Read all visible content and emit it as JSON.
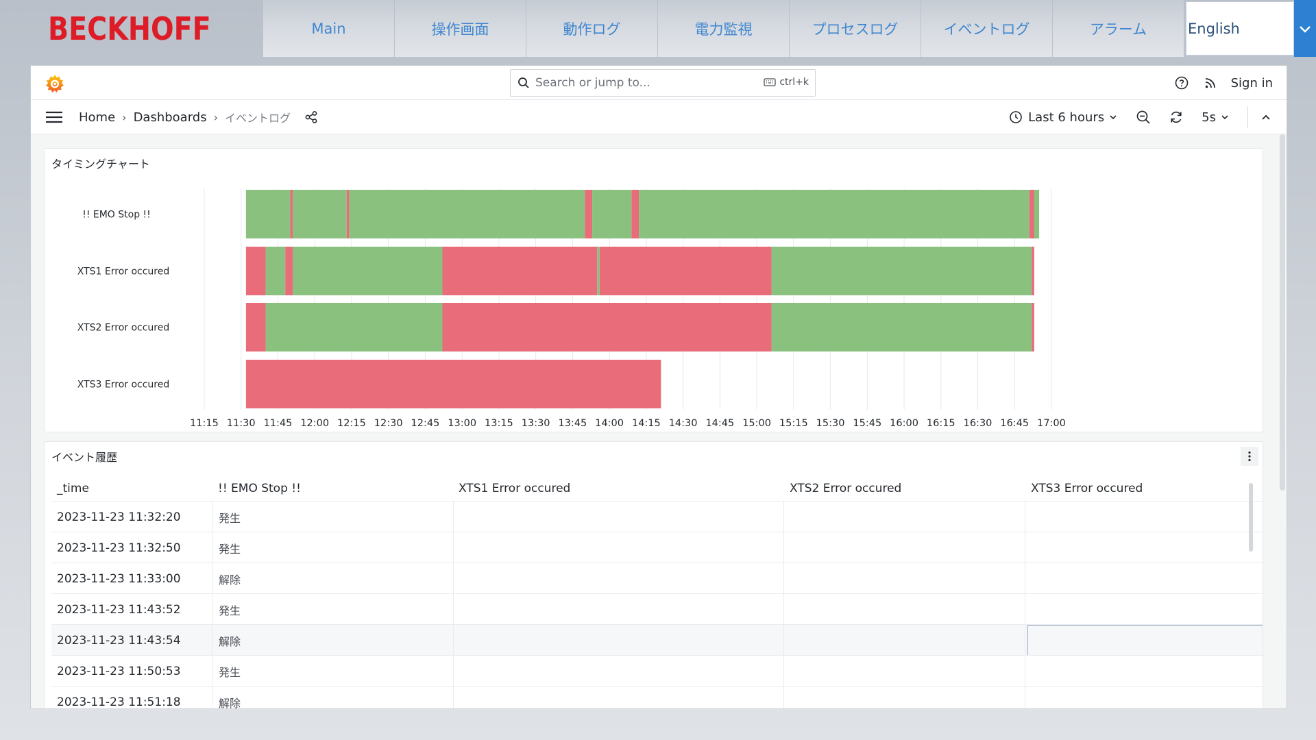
{
  "topnav": {
    "brand": "BECKHOFF",
    "tabs": [
      "Main",
      "操作画面",
      "動作ログ",
      "電力監視",
      "プロセスログ",
      "イベントログ",
      "アラーム"
    ],
    "language": "English"
  },
  "header": {
    "search_placeholder": "Search or jump to...",
    "search_shortcut": "ctrl+k",
    "sign_in": "Sign in"
  },
  "toolbar": {
    "breadcrumbs": [
      "Home",
      "Dashboards",
      "イベントログ"
    ],
    "time_range": "Last 6 hours",
    "refresh_interval": "5s"
  },
  "timing_panel": {
    "title": "タイミングチャート"
  },
  "colors": {
    "ok": "#8ac17f",
    "alarm": "#e86c7a",
    "brand_red": "#dd1c28",
    "nav_text": "#3f86cf",
    "accent_blue": "#2d80d2"
  },
  "chart_data": {
    "type": "state-timeline",
    "x_unit": "time (HH:MM)",
    "x_ticks": [
      "11:15",
      "11:30",
      "11:45",
      "12:00",
      "12:15",
      "12:30",
      "12:45",
      "13:00",
      "13:15",
      "13:30",
      "13:45",
      "14:00",
      "14:15",
      "14:30",
      "14:45",
      "15:00",
      "15:15",
      "15:30",
      "15:45",
      "16:00",
      "16:15",
      "16:30",
      "16:45",
      "17:00"
    ],
    "xlim": [
      "11:15",
      "17:00"
    ],
    "rows": [
      {
        "name": "!! EMO Stop !!",
        "segments": [
          {
            "start": "11:32",
            "end": "11:50",
            "state": "ok"
          },
          {
            "start": "11:50",
            "end": "11:51",
            "state": "alarm"
          },
          {
            "start": "11:51",
            "end": "12:13",
            "state": "ok"
          },
          {
            "start": "12:13",
            "end": "12:14",
            "state": "alarm"
          },
          {
            "start": "12:14",
            "end": "13:50",
            "state": "ok"
          },
          {
            "start": "13:50",
            "end": "13:53",
            "state": "alarm"
          },
          {
            "start": "13:53",
            "end": "14:09",
            "state": "ok"
          },
          {
            "start": "14:09",
            "end": "14:12",
            "state": "alarm"
          },
          {
            "start": "14:12",
            "end": "16:51",
            "state": "ok"
          },
          {
            "start": "16:51",
            "end": "16:53",
            "state": "alarm"
          },
          {
            "start": "16:53",
            "end": "16:55",
            "state": "ok"
          }
        ]
      },
      {
        "name": "XTS1 Error occured",
        "segments": [
          {
            "start": "11:32",
            "end": "11:40",
            "state": "alarm"
          },
          {
            "start": "11:40",
            "end": "11:48",
            "state": "ok"
          },
          {
            "start": "11:48",
            "end": "11:51",
            "state": "alarm"
          },
          {
            "start": "11:51",
            "end": "12:52",
            "state": "ok"
          },
          {
            "start": "12:52",
            "end": "13:55",
            "state": "alarm"
          },
          {
            "start": "13:55",
            "end": "13:56",
            "state": "ok"
          },
          {
            "start": "13:56",
            "end": "15:06",
            "state": "alarm"
          },
          {
            "start": "15:06",
            "end": "16:52",
            "state": "ok"
          },
          {
            "start": "16:52",
            "end": "16:53",
            "state": "alarm"
          }
        ]
      },
      {
        "name": "XTS2 Error occured",
        "segments": [
          {
            "start": "11:32",
            "end": "11:40",
            "state": "alarm"
          },
          {
            "start": "11:40",
            "end": "12:52",
            "state": "ok"
          },
          {
            "start": "12:52",
            "end": "15:06",
            "state": "alarm"
          },
          {
            "start": "15:06",
            "end": "16:52",
            "state": "ok"
          },
          {
            "start": "16:52",
            "end": "16:53",
            "state": "alarm"
          }
        ]
      },
      {
        "name": "XTS3 Error occured",
        "segments": [
          {
            "start": "11:32",
            "end": "14:21",
            "state": "alarm"
          }
        ]
      }
    ]
  },
  "event_panel": {
    "title": "イベント履歴",
    "columns": [
      "_time",
      "!! EMO Stop !!",
      "XTS1 Error occured",
      "XTS2 Error occured",
      "XTS3 Error occured"
    ],
    "rows": [
      [
        "2023-11-23 11:32:20",
        "発生",
        "",
        "",
        ""
      ],
      [
        "2023-11-23 11:32:50",
        "発生",
        "",
        "",
        ""
      ],
      [
        "2023-11-23 11:33:00",
        "解除",
        "",
        "",
        ""
      ],
      [
        "2023-11-23 11:43:52",
        "発生",
        "",
        "",
        ""
      ],
      [
        "2023-11-23 11:43:54",
        "解除",
        "",
        "",
        ""
      ],
      [
        "2023-11-23 11:50:53",
        "発生",
        "",
        "",
        ""
      ],
      [
        "2023-11-23 11:51:18",
        "解除",
        "",
        "",
        ""
      ]
    ]
  }
}
